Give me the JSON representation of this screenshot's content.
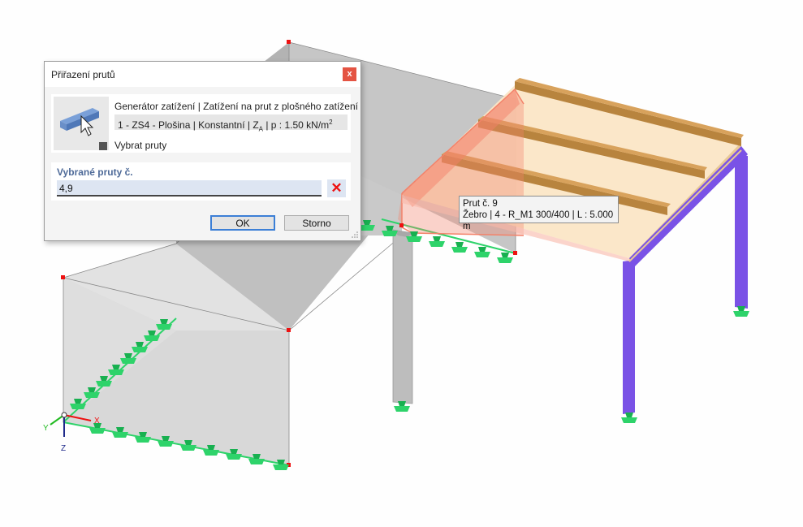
{
  "dialog": {
    "title": "Přiřazení prutů",
    "close_label": "x",
    "generator_text": "Generátor zatížení | Zatížení na prut z plošného zatížení",
    "load_case_prefix": "1 - ZS4 - Plošina | Konstantní | Z",
    "load_case_sub": "A",
    "load_case_suffix": " | p : 1.50 kN/m",
    "load_case_sup": "2",
    "select_members_label": "Vybrat pruty",
    "selected_members_label": "Vybrané pruty č.",
    "selected_members_value": "4,9",
    "ok_label": "OK",
    "cancel_label": "Storno"
  },
  "tooltip": {
    "line1": "Prut č. 9",
    "line2": "Žebro | 4 - R_M1 300/400 | L : 5.000 m"
  },
  "axes": {
    "x": "X",
    "y": "Y",
    "z": "Z"
  },
  "colors": {
    "accent": "#3c7fd6",
    "close": "#e45443",
    "support": "#2ed36a",
    "column_blue": "#7a52e6",
    "beam_brown": "#b8843e",
    "selection": "#f3826a",
    "wall_gray": "#cdcdcd"
  }
}
